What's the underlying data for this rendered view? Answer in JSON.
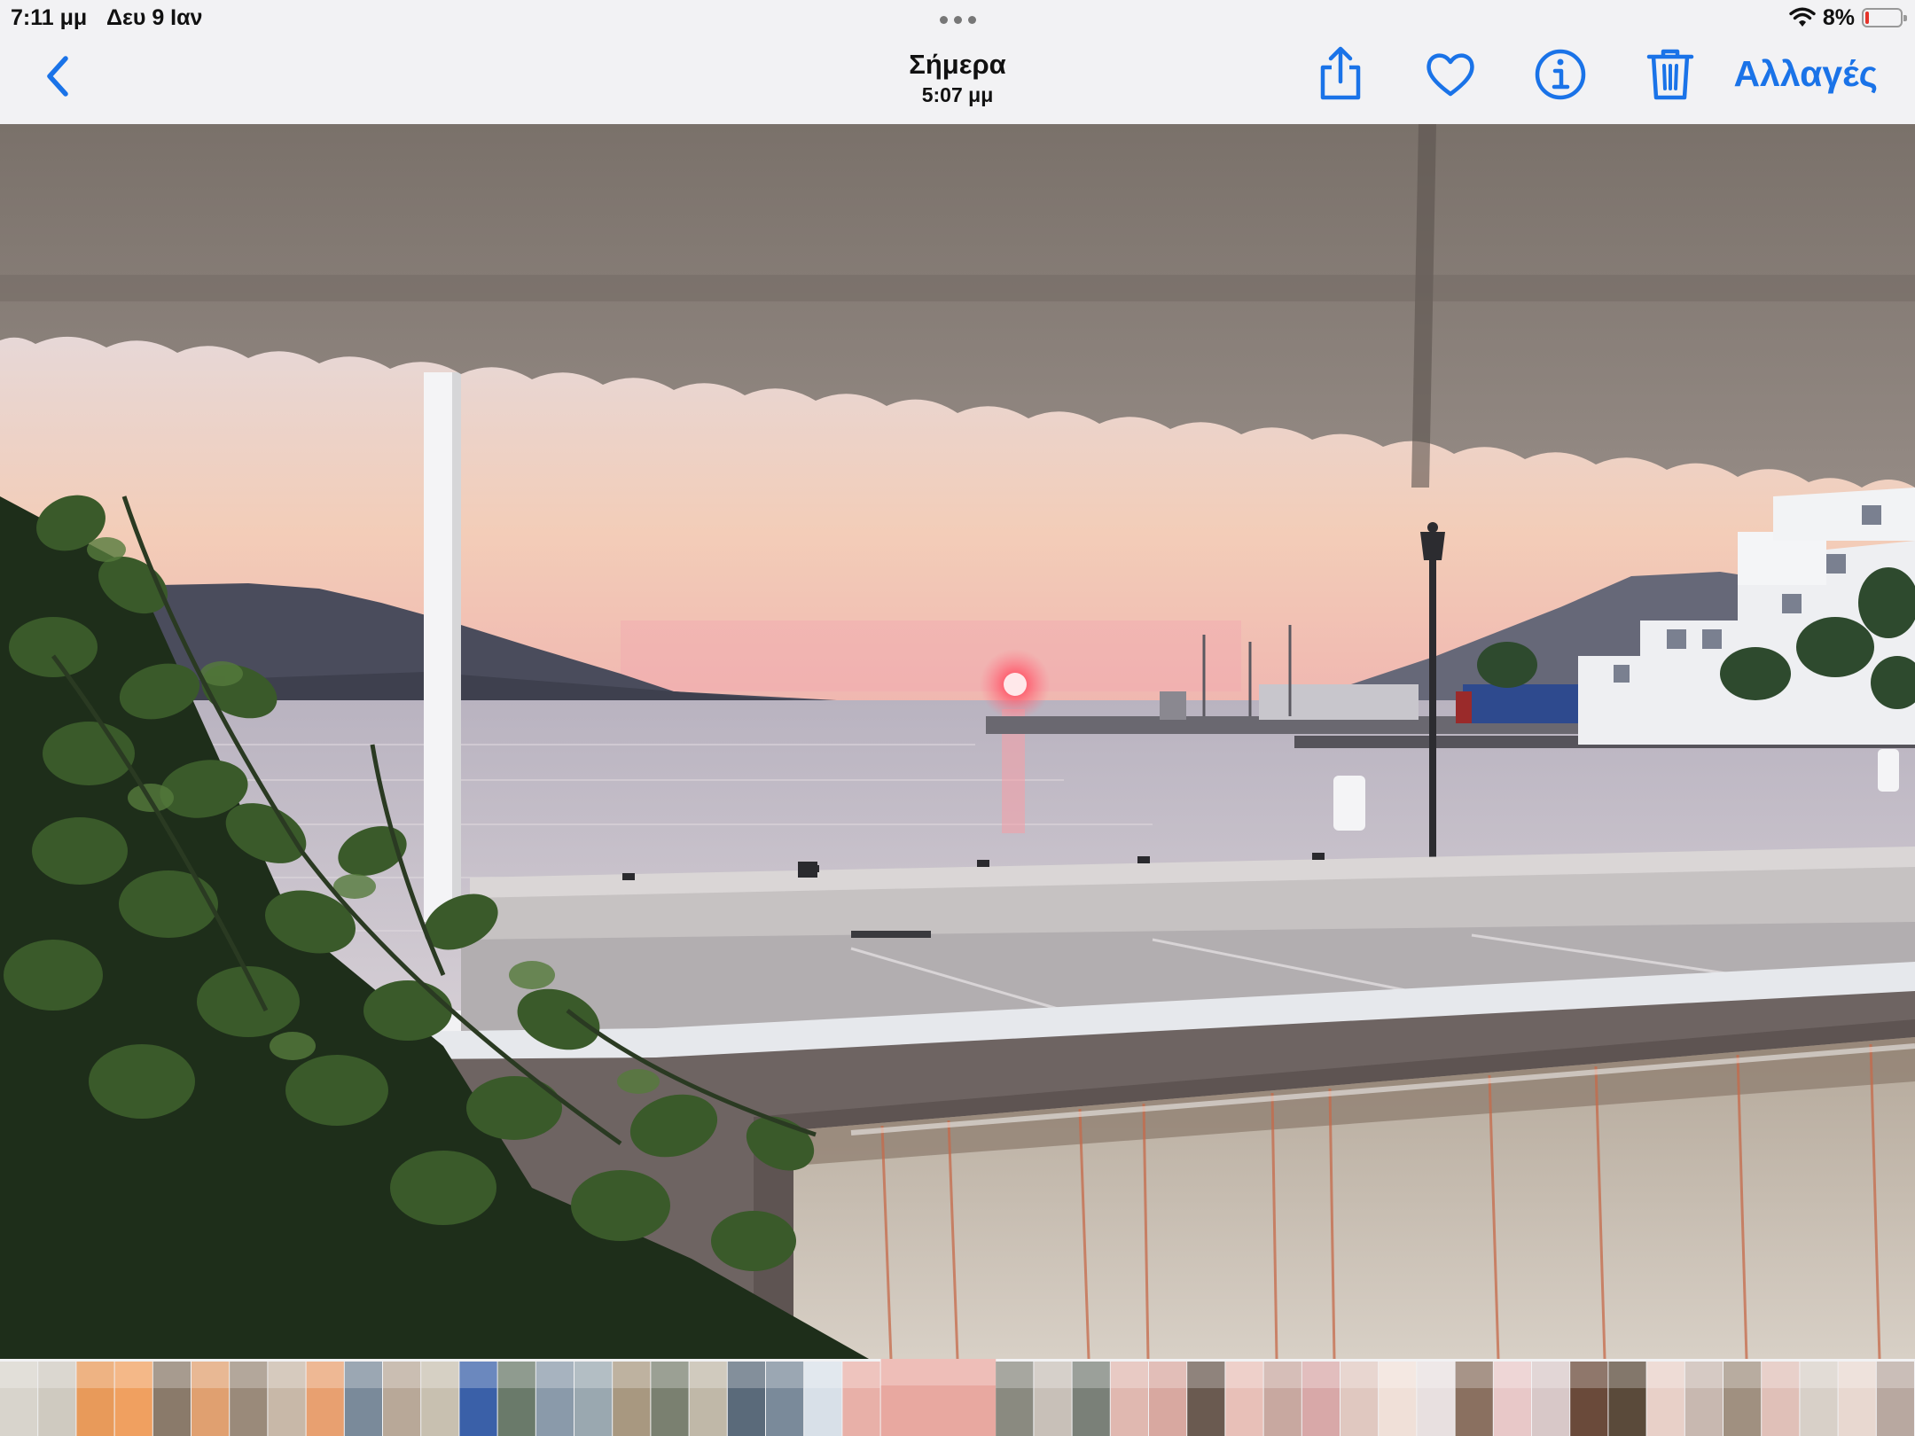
{
  "status_bar": {
    "time": "7:11 μμ",
    "date": "Δευ 9 Ιαν",
    "battery": "8%"
  },
  "nav": {
    "title": "Σήμερα",
    "subtitle": "5:07 μμ",
    "edit_label": "Αλλαγές",
    "icons": [
      "chevron-left-icon",
      "share-icon",
      "heart-icon",
      "info-icon",
      "trash-icon"
    ]
  },
  "colors": {
    "accent": "#1a73e8",
    "battery_low": "#e5332a"
  },
  "photo": {
    "subject": "sunset-harbor-view"
  },
  "thumbnails": {
    "count": 50,
    "colors": [
      "#d8d4cc",
      "#cfcac0",
      "#e89a5a",
      "#f0a060",
      "#8a7a6a",
      "#e0a070",
      "#9a8a7a",
      "#c8b8a8",
      "#e8a070",
      "#7a8a9a",
      "#b8a898",
      "#c8c0b0",
      "#3a60a8",
      "#6a7a6a",
      "#8a9aaa",
      "#9aa8b0",
      "#a89880",
      "#7a8070",
      "#c0b8a8",
      "#5a6a7a",
      "#7a8a9a",
      "#d8e0e8",
      "#e8b0a8",
      "#e8a8a0",
      "#f0f0f0",
      "#9aa0a8",
      "#8a8a80",
      "#c8c0b8",
      "#7a8078",
      "#e0b8b0",
      "#d8a8a0",
      "#6a5a50",
      "#e8c0b8",
      "#c8a8a0",
      "#d8a8a8",
      "#e0c8c0",
      "#f0e0d8",
      "#e8e0e0",
      "#8a7060",
      "#e8c8c8",
      "#d8c8c8",
      "#6a4a3a",
      "#5a4a3a",
      "#e8d0c8",
      "#c8b8b0",
      "#a09080",
      "#e0c0b8",
      "#d8d0c8",
      "#e8d8d0",
      "#b8a8a0"
    ]
  }
}
